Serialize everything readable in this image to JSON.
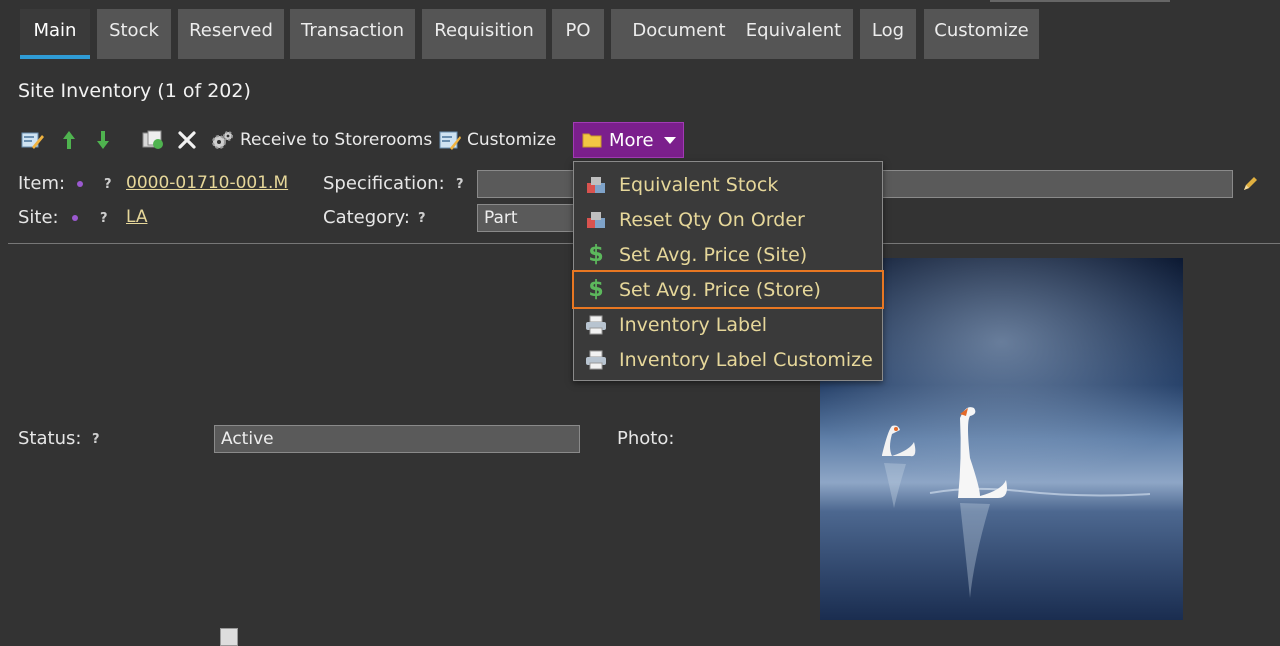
{
  "tabs": [
    "Main",
    "Stock",
    "Reserved",
    "Transaction",
    "Requisition",
    "PO",
    "Document",
    "Equivalent",
    "Log",
    "Customize"
  ],
  "title": "Site Inventory (1 of 202)",
  "toolbar": {
    "receive_label": "Receive to Storerooms",
    "customize_label": "Customize",
    "more_label": "More"
  },
  "menu": {
    "items": [
      {
        "label": "Equivalent Stock",
        "icon": "boxes-icon"
      },
      {
        "label": "Reset Qty On Order",
        "icon": "boxes-icon"
      },
      {
        "label": "Set Avg. Price (Site)",
        "icon": "dollar-icon"
      },
      {
        "label": "Set Avg. Price (Store)",
        "icon": "dollar-icon",
        "highlighted": true
      },
      {
        "label": "Inventory Label",
        "icon": "printer-icon"
      },
      {
        "label": "Inventory Label Customize",
        "icon": "printer-icon"
      }
    ]
  },
  "form": {
    "item_label": "Item:",
    "item_value": "0000-01710-001.M",
    "site_label": "Site:",
    "site_value": "LA",
    "spec_label": "Specification:",
    "category_label": "Category:",
    "category_value": "Part",
    "status_label": "Status:",
    "status_value": "Active",
    "photo_label": "Photo:",
    "help_glyph": "?"
  },
  "colors": {
    "accent": "#2f9cd6",
    "more_button": "#7b1f8c",
    "link": "#e6d79a",
    "highlight": "#e87722"
  }
}
